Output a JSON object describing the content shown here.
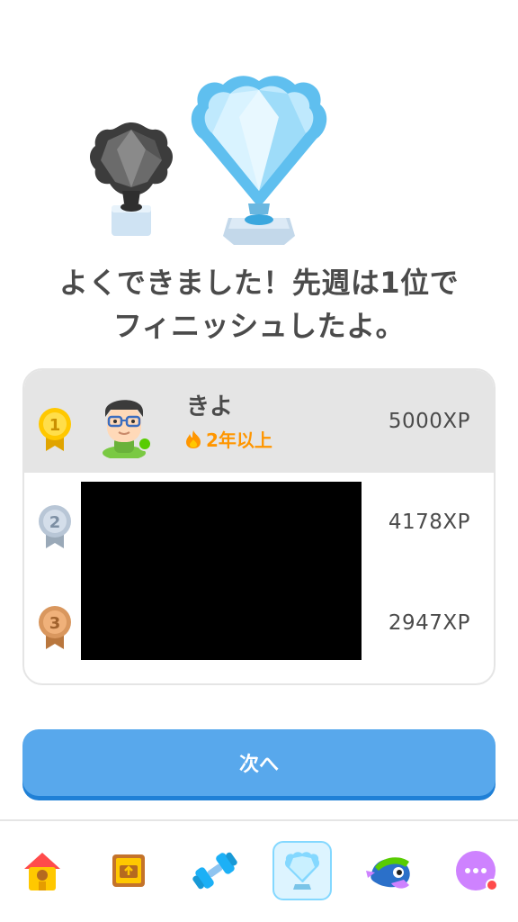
{
  "headline": {
    "line1": "よくできました！先週は1位で",
    "line2": "フィニッシュしたよ。"
  },
  "leaderboard": [
    {
      "rank": "1",
      "name": "きよ",
      "streak": "2年以上",
      "xp": "5000XP"
    },
    {
      "rank": "2",
      "xp": "4178XP"
    },
    {
      "rank": "3",
      "xp": "2947XP"
    }
  ],
  "next_label": "次へ",
  "colors": {
    "accent": "#58a8ec",
    "highlight_row": "#e5e5e5",
    "streak": "#ff9600",
    "gold": "#ffc800",
    "silver": "#b8c6d6",
    "bronze": "#d9975e"
  },
  "tabs": [
    {
      "icon": "home-icon",
      "active": false
    },
    {
      "icon": "treasure-chest-icon",
      "active": false
    },
    {
      "icon": "dumbbell-icon",
      "active": false
    },
    {
      "icon": "trophy-icon",
      "active": true
    },
    {
      "icon": "mascot-icon",
      "active": false
    },
    {
      "icon": "more-icon",
      "active": false
    }
  ]
}
